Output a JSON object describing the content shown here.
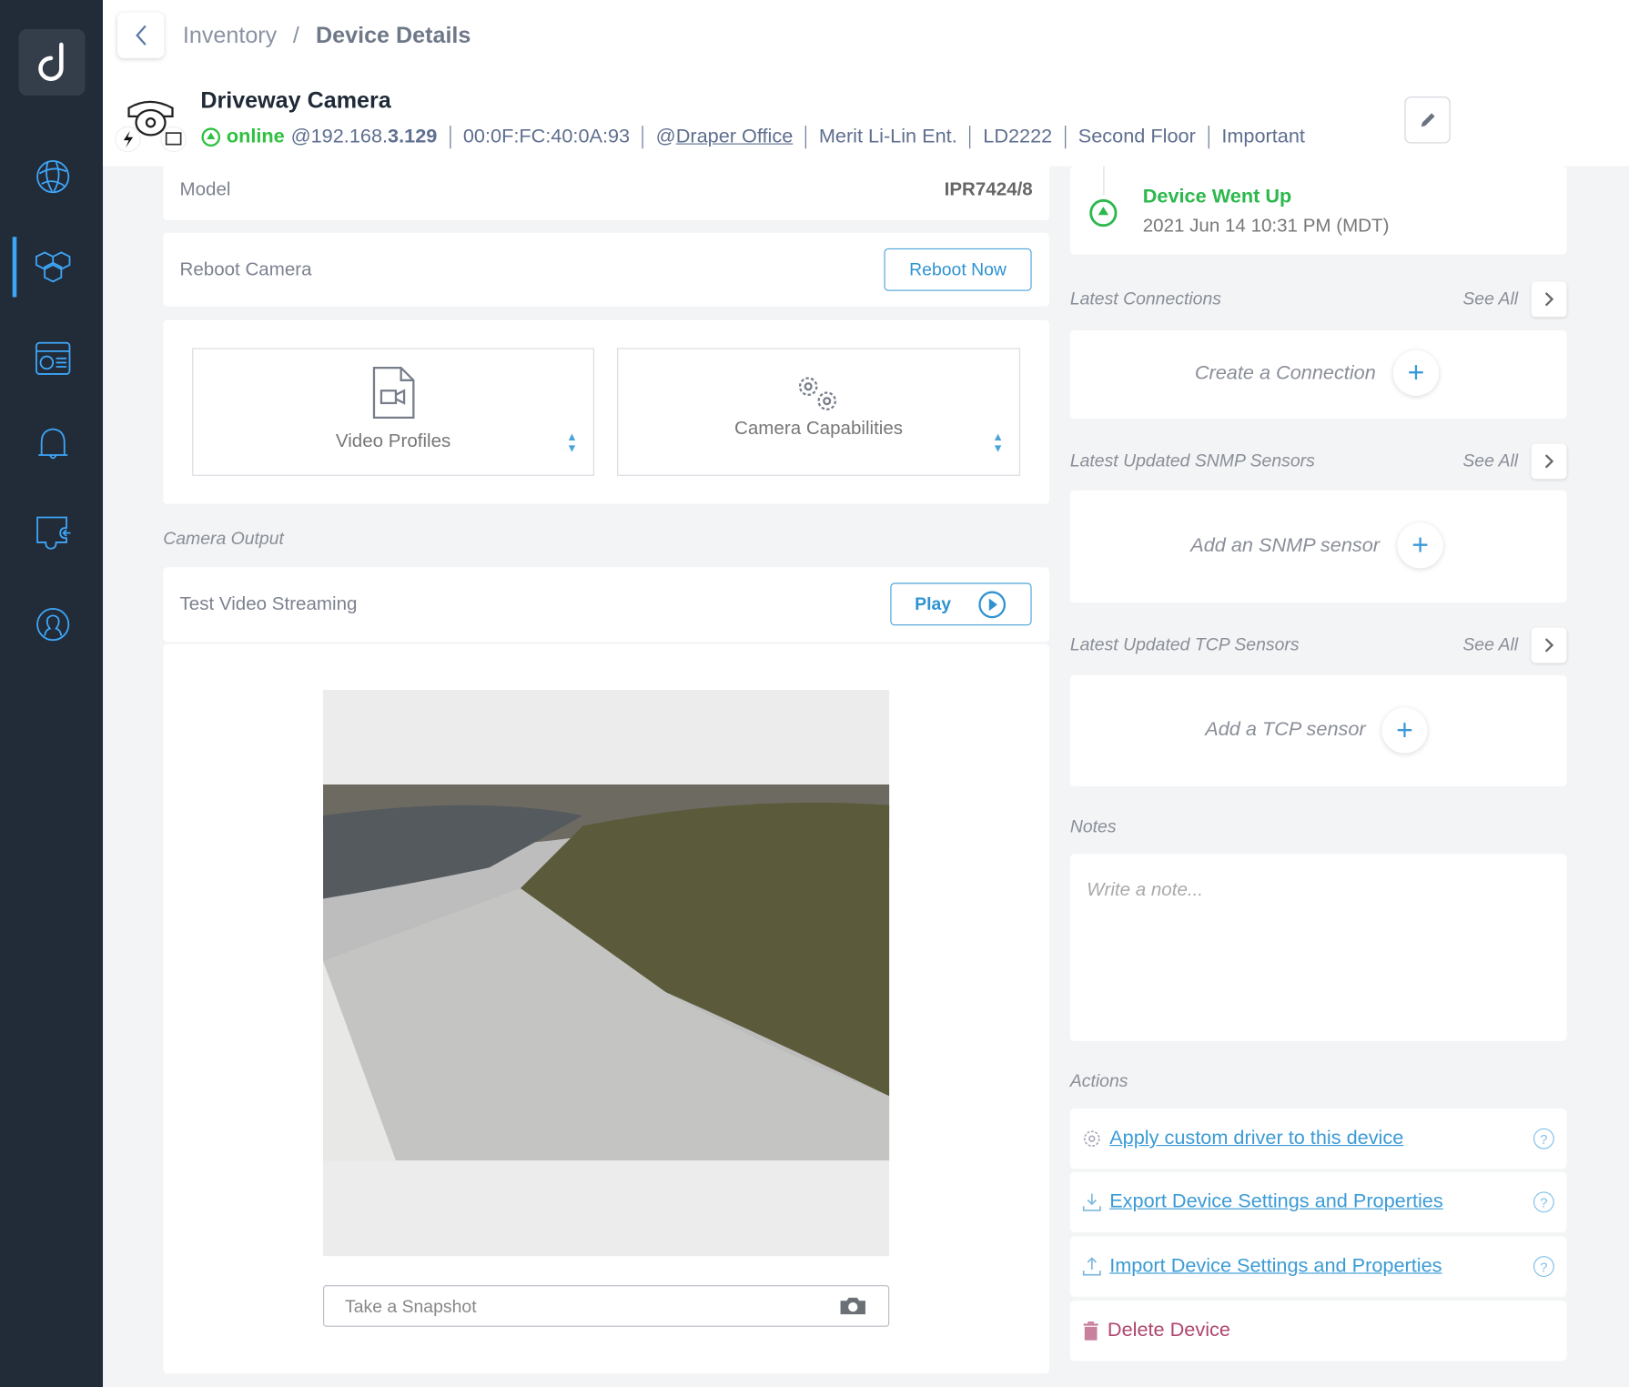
{
  "sidebar": {
    "logo": "d",
    "items": [
      {
        "name": "network",
        "icon": "globe-icon"
      },
      {
        "name": "inventory",
        "icon": "cubes-icon",
        "active": true
      },
      {
        "name": "dashboard",
        "icon": "dashboard-icon"
      },
      {
        "name": "alerts",
        "icon": "bell-icon"
      },
      {
        "name": "integrations",
        "icon": "puzzle-icon"
      },
      {
        "name": "account",
        "icon": "user-icon"
      }
    ],
    "accent": "#3ea6f7"
  },
  "breadcrumb": {
    "parent": "Inventory",
    "separator": "/",
    "current": "Device Details"
  },
  "device": {
    "name": "Driveway Camera",
    "status": "online",
    "ip_prefix": "@192.168.",
    "ip_suffix": "3.129",
    "mac": "00:0F:FC:40:0A:93",
    "site_prefix": "@",
    "site": "Draper Office",
    "vendor": "Merit Li-Lin Ent.",
    "model_code": "LD2222",
    "location": "Second Floor",
    "tag": "Important"
  },
  "model": {
    "label": "Model",
    "value": "IPR7424/8"
  },
  "reboot": {
    "label": "Reboot Camera",
    "button": "Reboot Now"
  },
  "profiles": {
    "video_profiles": "Video Profiles",
    "camera_capabilities": "Camera Capabilities"
  },
  "camera_output": {
    "section": "Camera Output",
    "stream_label": "Test Video Streaming",
    "play": "Play",
    "snapshot_placeholder": "Take a Snapshot"
  },
  "event": {
    "title": "Device Went Up",
    "time": "2021 Jun 14 10:31 PM (MDT)",
    "color": "#2db84d"
  },
  "connections": {
    "title": "Latest Connections",
    "see_all": "See All",
    "action": "Create a Connection"
  },
  "snmp": {
    "title": "Latest Updated SNMP Sensors",
    "see_all": "See All",
    "action": "Add an SNMP sensor"
  },
  "tcp": {
    "title": "Latest Updated TCP Sensors",
    "see_all": "See All",
    "action": "Add a TCP sensor"
  },
  "notes": {
    "title": "Notes",
    "placeholder": "Write a note..."
  },
  "actions": {
    "title": "Actions",
    "items": [
      "Apply custom driver to this device",
      "Export Device Settings and Properties",
      "Import Device Settings and Properties"
    ],
    "delete": "Delete Device",
    "delete_color": "#b0456e"
  }
}
